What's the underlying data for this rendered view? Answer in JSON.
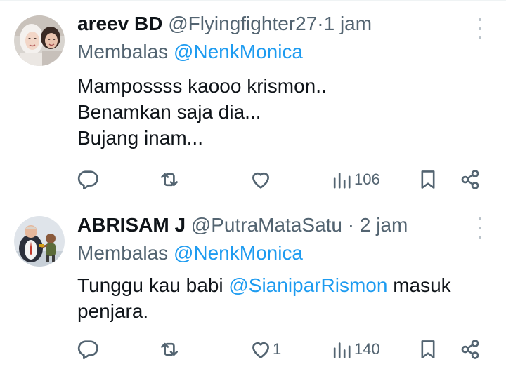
{
  "tweets": [
    {
      "author_name": "areev BD",
      "handle": "@Flyingfighter27",
      "separator": "·",
      "time": "1 jam",
      "replying_prefix": "Membalas",
      "replying_to": "@NenkMonica",
      "body_lines": [
        "Mampossss kaooo krismon..",
        "Benamkan saja dia...",
        "Bujang inam..."
      ],
      "likes": "",
      "views": "106",
      "avatar_icon": "two-women-selfie-avatar"
    },
    {
      "author_name": "ABRISAM J",
      "handle": "@PutraMataSatu",
      "separator": "·",
      "time": "2 jam",
      "replying_prefix": "Membalas",
      "replying_to": "@NenkMonica",
      "body_prefix": "Tunggu kau babi ",
      "body_mention": "@SianiparRismon",
      "body_suffix": " masuk",
      "body_line2": "penjara.",
      "likes": "1",
      "views": "140",
      "avatar_icon": "cartoon-characters-avatar"
    }
  ],
  "colors": {
    "text": "#0f1419",
    "secondary": "#536471",
    "link": "#1d9bf0",
    "divider": "#eff3f4"
  },
  "icons": [
    "reply-icon",
    "retweet-icon",
    "like-icon",
    "views-icon",
    "bookmark-icon",
    "share-icon",
    "more-icon"
  ]
}
